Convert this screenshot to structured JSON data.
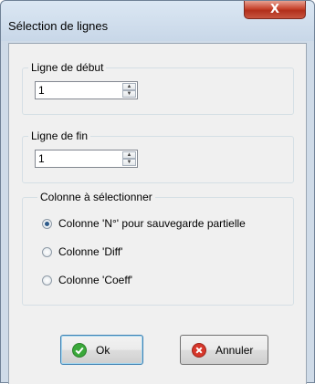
{
  "window": {
    "title": "Sélection de lignes",
    "close_glyph": "X"
  },
  "start_line": {
    "label": "Ligne de début",
    "value": "1"
  },
  "end_line": {
    "label": "Ligne de fin",
    "value": "1"
  },
  "column_group": {
    "label": "Colonne à sélectionner",
    "options": [
      {
        "label": "Colonne 'N°' pour sauvegarde partielle",
        "selected": true
      },
      {
        "label": "Colonne 'Diff'",
        "selected": false
      },
      {
        "label": "Colonne 'Coeff'",
        "selected": false
      }
    ]
  },
  "buttons": {
    "ok": {
      "label": "Ok",
      "icon": "check-icon",
      "color": "#3aa83a"
    },
    "cancel": {
      "label": "Annuler",
      "icon": "cancel-icon",
      "color": "#d6372b"
    }
  },
  "colors": {
    "titlebar": "#c8d7e8",
    "close_button": "#c7442e",
    "dialog_background": "#f0f0f0"
  }
}
